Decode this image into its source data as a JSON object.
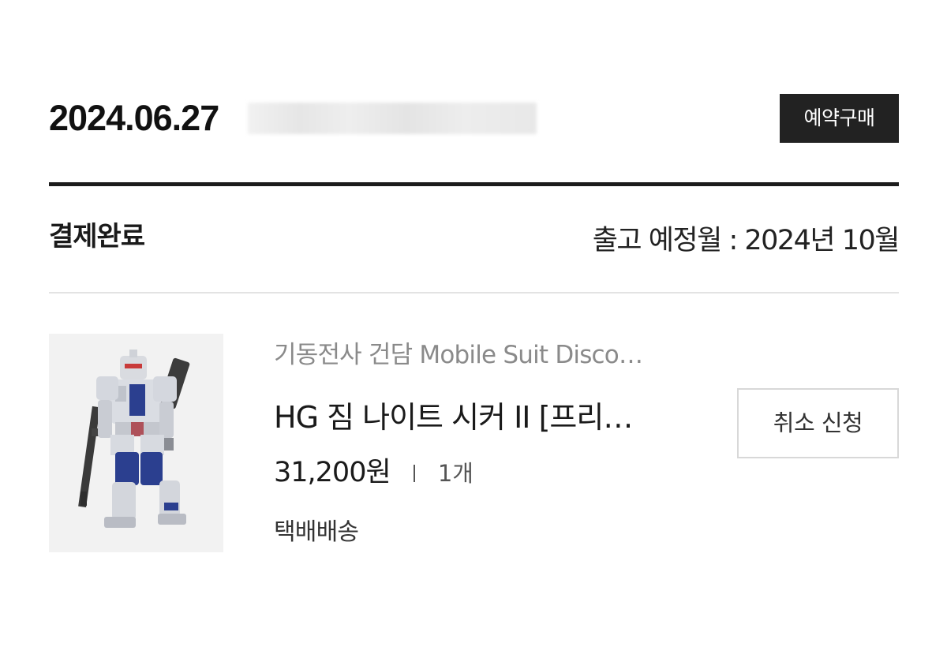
{
  "order": {
    "date": "2024.06.27",
    "badge": "예약구매",
    "status": "결제완료",
    "shipping_schedule": "출고 예정월 : 2024년 10월"
  },
  "product": {
    "series": "기동전사 건담 Mobile Suit Disco…",
    "name": "HG 짐 나이트 시커 II [프리…",
    "price": "31,200원",
    "quantity": "1개",
    "delivery": "택배배송",
    "image_icon": "gundam-model-figure",
    "colors": {
      "armor_white": "#d9dbe0",
      "armor_blue": "#2b3f8f",
      "visor_red": "#c83a3a",
      "weapon_dark": "#3a3a3a"
    }
  },
  "actions": {
    "cancel_label": "취소 신청"
  },
  "colors": {
    "badge_bg": "#222222",
    "divider_thick": "#1c1c1c",
    "divider_thin": "#e3e3e3",
    "thumb_bg": "#f2f2f2"
  }
}
